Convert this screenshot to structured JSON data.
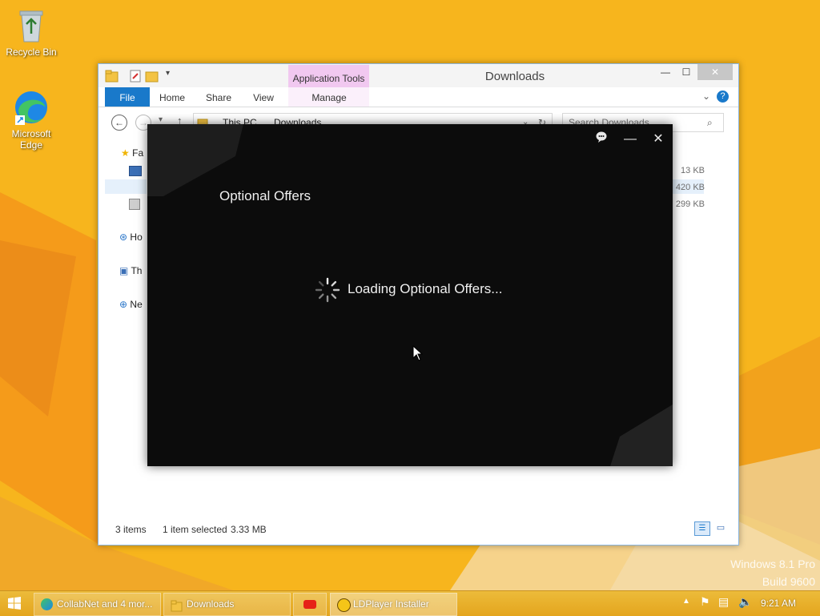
{
  "desktop": {
    "icons": [
      {
        "label": "Recycle Bin",
        "icon": "recycle-bin-icon"
      },
      {
        "label": "Microsoft Edge",
        "icon": "edge-icon"
      }
    ],
    "watermark_line1": "Windows 8.1 Pro",
    "watermark_line2": "Build 9600"
  },
  "explorer": {
    "title": "Downloads",
    "context_tab": "Application Tools",
    "tabs": [
      "File",
      "Home",
      "Share",
      "View",
      "Manage"
    ],
    "address": {
      "parts": [
        "This PC",
        "Downloads"
      ]
    },
    "search_placeholder": "Search Downloads",
    "sidebar": {
      "favorites": "Fa",
      "homegroup": "Ho",
      "thispc": "Th",
      "network": "Ne"
    },
    "file_sizes": [
      "13 KB",
      "420 KB",
      "299 KB"
    ],
    "status": {
      "items": "3 items",
      "selected": "1 item selected",
      "size": "3.33 MB"
    }
  },
  "installer": {
    "heading": "Optional Offers",
    "loading_text": "Loading Optional Offers..."
  },
  "taskbar": {
    "buttons": [
      {
        "label": "CollabNet and 4 mor..."
      },
      {
        "label": "Downloads"
      },
      {
        "label": ""
      },
      {
        "label": "LDPlayer Installer"
      }
    ],
    "time": "9:21 AM"
  },
  "colors": {
    "wallpaper": "#f6b41c",
    "accent_blue": "#1979ca",
    "context_pink": "#f1c8f0",
    "installer_bg": "#0c0c0c"
  }
}
